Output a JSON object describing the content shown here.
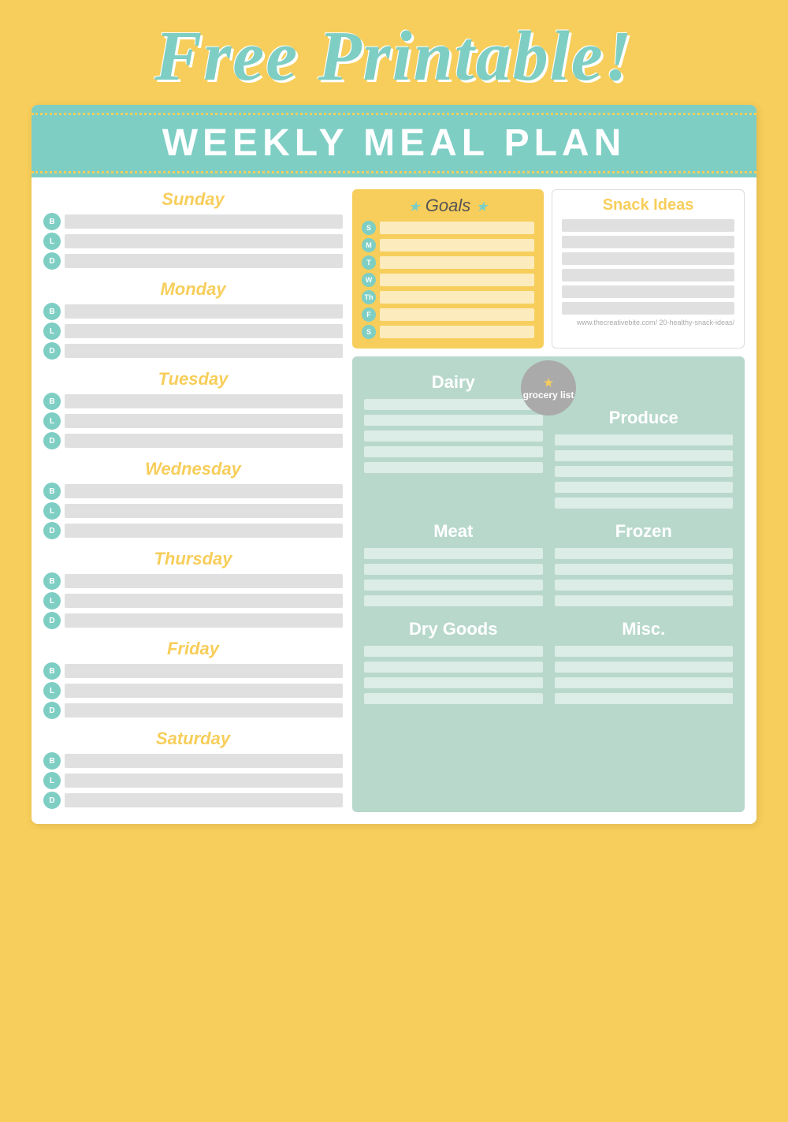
{
  "page": {
    "title": "Free Printable!",
    "card_title": "WEEKLY MEAL PLAN",
    "background_color": "#F7CE5B",
    "header_color": "#7ecec4",
    "grocery_bg": "#b8d8cc"
  },
  "days": [
    {
      "name": "Sunday",
      "meals": [
        "B",
        "L",
        "D"
      ]
    },
    {
      "name": "Monday",
      "meals": [
        "B",
        "L",
        "D"
      ]
    },
    {
      "name": "Tuesday",
      "meals": [
        "B",
        "L",
        "D"
      ]
    },
    {
      "name": "Wednesday",
      "meals": [
        "B",
        "L",
        "D"
      ]
    },
    {
      "name": "Thursday",
      "meals": [
        "B",
        "L",
        "D"
      ]
    },
    {
      "name": "Friday",
      "meals": [
        "B",
        "L",
        "D"
      ]
    },
    {
      "name": "Saturday",
      "meals": [
        "B",
        "L",
        "D"
      ]
    }
  ],
  "goals": {
    "title": "Goals",
    "days": [
      "S",
      "M",
      "T",
      "W",
      "Th",
      "F",
      "S"
    ]
  },
  "snack": {
    "title": "Snack Ideas",
    "url": "www.thecreativebite.com/\n20-healthy-snack-ideas/"
  },
  "grocery": {
    "badge": "grocery list",
    "categories": [
      {
        "name": "Dairy",
        "position": "top-left"
      },
      {
        "name": "Produce",
        "position": "top-right"
      },
      {
        "name": "Meat",
        "position": "mid-left"
      },
      {
        "name": "Frozen",
        "position": "mid-right"
      },
      {
        "name": "Dry Goods",
        "position": "bot-left"
      },
      {
        "name": "Misc.",
        "position": "bot-right"
      }
    ]
  }
}
